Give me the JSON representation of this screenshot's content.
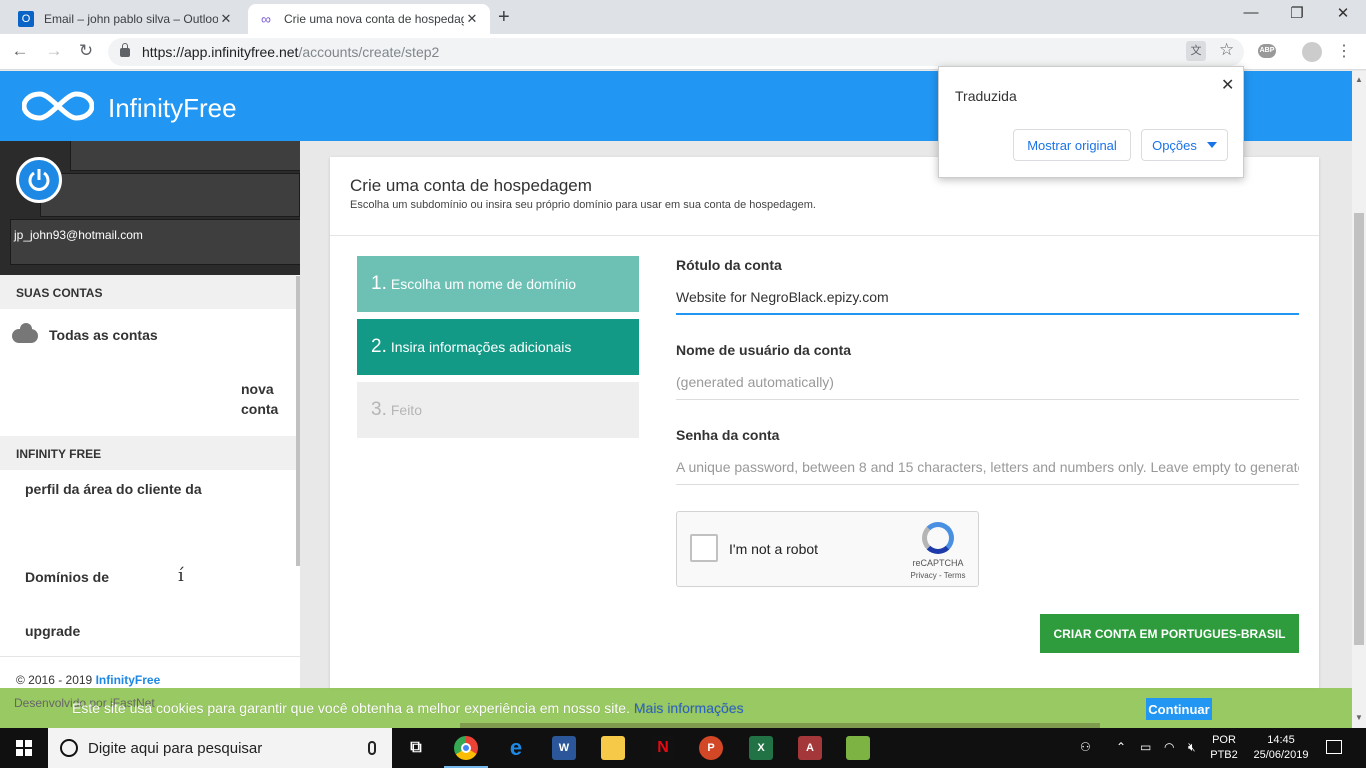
{
  "browser": {
    "tabs": [
      {
        "title": "Email – john pablo silva – Outlook",
        "active": false
      },
      {
        "title": "Crie uma nova conta de hospedagem",
        "active": true
      }
    ],
    "url_host": "https://app.infinityfree.net",
    "url_path": "/accounts/create/step2",
    "abp_badge": "ABP"
  },
  "translate_popup": {
    "title": "Traduzida",
    "show_original": "Mostrar original",
    "options": "Opções"
  },
  "site": {
    "brand": "InfinityFree",
    "header_color": "#2196f3"
  },
  "sidebar": {
    "email": "jp_john93@hotmail.com",
    "section_accounts": "SUAS CONTAS",
    "all_accounts": "Todas as contas",
    "new_account_1": "nova",
    "new_account_2": "conta",
    "section_infinity": "INFINITY FREE",
    "client_profile": "perfil da área do cliente da",
    "domains": "Domínios de",
    "stray_char": "í",
    "upgrade": "upgrade",
    "copyright": "© 2016 - 2019 ",
    "copyright_brand": "InfinityFree",
    "developed_hidden": "Desenvolvido por iFastNet"
  },
  "main": {
    "title": "Crie uma conta de hospedagem",
    "subtitle": "Escolha um subdomínio ou insira seu próprio domínio para usar em sua conta de hospedagem.",
    "steps": [
      {
        "num": "1.",
        "label": "Escolha um nome de domínio",
        "state": "done"
      },
      {
        "num": "2.",
        "label": "Insira informações adicionais",
        "state": "active"
      },
      {
        "num": "3.",
        "label": "Feito",
        "state": "pending"
      }
    ],
    "fields": {
      "label_label": "Rótulo da conta",
      "label_value": "Website for NegroBlack.epizy.com",
      "username_label": "Nome de usuário da conta",
      "username_placeholder": "(generated automatically)",
      "password_label": "Senha da conta",
      "password_placeholder": "A unique password, between 8 and 15 characters, letters and numbers only. Leave empty to generate"
    },
    "recaptcha": {
      "label": "I'm not a robot",
      "brand": "reCAPTCHA",
      "links": "Privacy - Terms"
    },
    "submit": "CRIAR CONTA EM PORTUGUES-BRASIL"
  },
  "cookie_bar": {
    "message": "Este site usa cookies para garantir que você obtenha a melhor experiência em nosso site.",
    "more": "Mais informações",
    "accept": "Continuar"
  },
  "taskbar": {
    "search_placeholder": "Digite aqui para pesquisar",
    "lang_1": "POR",
    "lang_2": "PTB2",
    "time": "14:45",
    "date": "25/06/2019"
  }
}
